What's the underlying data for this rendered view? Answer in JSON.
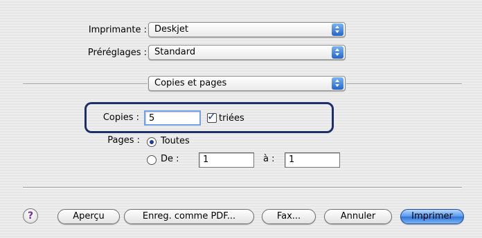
{
  "printer": {
    "label": "Imprimante :",
    "value": "Deskjet"
  },
  "presets": {
    "label": "Préréglages :",
    "value": "Standard"
  },
  "panel": {
    "value": "Copies et pages"
  },
  "copies": {
    "label": "Copies :",
    "value": "5",
    "collate_label": "triées",
    "collated": true
  },
  "pages": {
    "label": "Pages :",
    "all_label": "Toutes",
    "range_label": "De :",
    "from_value": "1",
    "to_label": "à :",
    "to_value": "1",
    "selected": "all"
  },
  "buttons": {
    "help": "?",
    "preview": "Aperçu",
    "save_pdf": "Enreg. comme PDF...",
    "fax": "Fax...",
    "cancel": "Annuler",
    "print": "Imprimer"
  },
  "colors": {
    "focus_ring": "#1d2f6b",
    "default_button": "#3d82e0"
  }
}
